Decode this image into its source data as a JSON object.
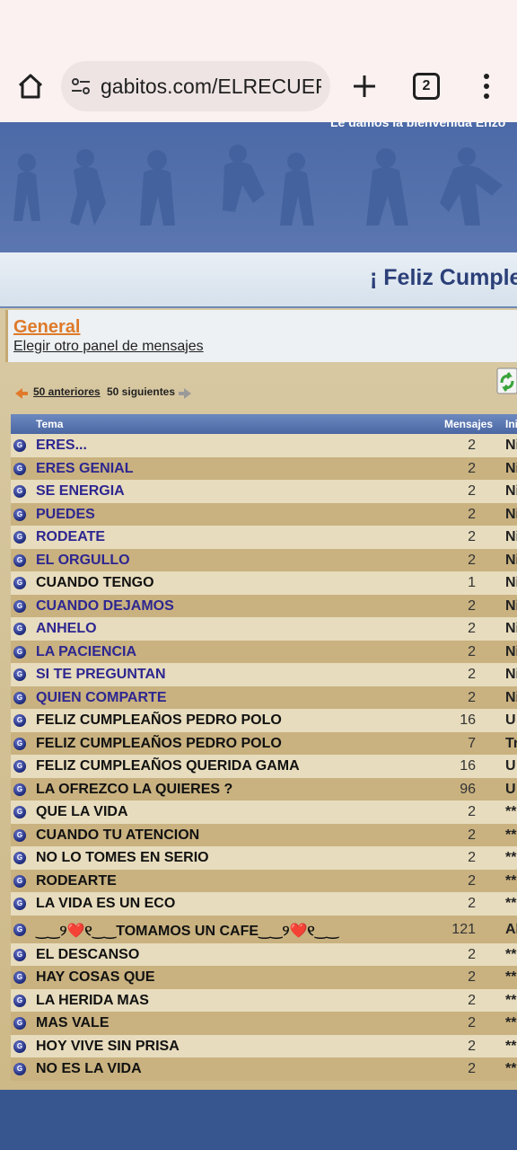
{
  "browser": {
    "url": "gabitos.com/ELRECUERI",
    "tab_count": "2"
  },
  "banner": {
    "welcome": "Le damos la bienvenida Enzo"
  },
  "marquee": {
    "text": "¡ Feliz Cumple"
  },
  "forum": {
    "title": "General",
    "other_panel": "Elegir otro panel de mensajes"
  },
  "pager": {
    "prev": "50 anteriores",
    "next": "50 siguientes"
  },
  "table": {
    "headers": {
      "topic": "Tema",
      "messages": "Mensajes",
      "initiated": "Ini"
    },
    "rows": [
      {
        "title": "ERES...",
        "count": "2",
        "init": "Ni",
        "read": true
      },
      {
        "title": "ERES GENIAL",
        "count": "2",
        "init": "Ni",
        "read": true
      },
      {
        "title": "SE ENERGIA",
        "count": "2",
        "init": "Ni",
        "read": true
      },
      {
        "title": "PUEDES",
        "count": "2",
        "init": "Ni",
        "read": true
      },
      {
        "title": "RODEATE",
        "count": "2",
        "init": "Ni",
        "read": true
      },
      {
        "title": "EL ORGULLO",
        "count": "2",
        "init": "Ni",
        "read": true
      },
      {
        "title": "CUANDO TENGO",
        "count": "1",
        "init": "Ni",
        "read": false
      },
      {
        "title": "CUANDO DEJAMOS",
        "count": "2",
        "init": "Ni",
        "read": true
      },
      {
        "title": "ANHELO",
        "count": "2",
        "init": "Ni",
        "read": true
      },
      {
        "title": "LA PACIENCIA",
        "count": "2",
        "init": "Ni",
        "read": true
      },
      {
        "title": "SI TE PREGUNTAN",
        "count": "2",
        "init": "Ni",
        "read": true
      },
      {
        "title": "QUIEN COMPARTE",
        "count": "2",
        "init": "Ni",
        "read": true
      },
      {
        "title": "FELIZ CUMPLEAÑOS PEDRO POLO",
        "count": "16",
        "init": "U",
        "read": false
      },
      {
        "title": "FELIZ CUMPLEAÑOS PEDRO POLO",
        "count": "7",
        "init": "Tr",
        "read": false
      },
      {
        "title": "FELIZ CUMPLEAÑOS QUERIDA GAMA",
        "count": "16",
        "init": "U",
        "read": false
      },
      {
        "title": "LA OFREZCO LA QUIERES ?",
        "count": "96",
        "init": "U",
        "read": false
      },
      {
        "title": "QUE LA VIDA",
        "count": "2",
        "init": "**",
        "read": false
      },
      {
        "title": "CUANDO TU ATENCION",
        "count": "2",
        "init": "**",
        "read": false
      },
      {
        "title": "NO LO TOMES EN SERIO",
        "count": "2",
        "init": "**",
        "read": false
      },
      {
        "title": "RODEARTE",
        "count": "2",
        "init": "**",
        "read": false
      },
      {
        "title": "LA VIDA ES UN ECO",
        "count": "2",
        "init": "**",
        "read": false
      },
      {
        "title": "‿‿୨❤️୧‿‿TOMAMOS UN CAFE‿‿୨❤️୧‿‿",
        "count": "121",
        "init": "Al",
        "read": false,
        "tall": true
      },
      {
        "title": "EL DESCANSO",
        "count": "2",
        "init": "**",
        "read": false
      },
      {
        "title": "HAY COSAS QUE",
        "count": "2",
        "init": "**",
        "read": false
      },
      {
        "title": "LA HERIDA MAS",
        "count": "2",
        "init": "**",
        "read": false
      },
      {
        "title": "MAS VALE",
        "count": "2",
        "init": "**",
        "read": false
      },
      {
        "title": "HOY VIVE SIN PRISA",
        "count": "2",
        "init": "**",
        "read": false
      },
      {
        "title": "NO ES LA VIDA",
        "count": "2",
        "init": "**",
        "read": false
      }
    ]
  }
}
